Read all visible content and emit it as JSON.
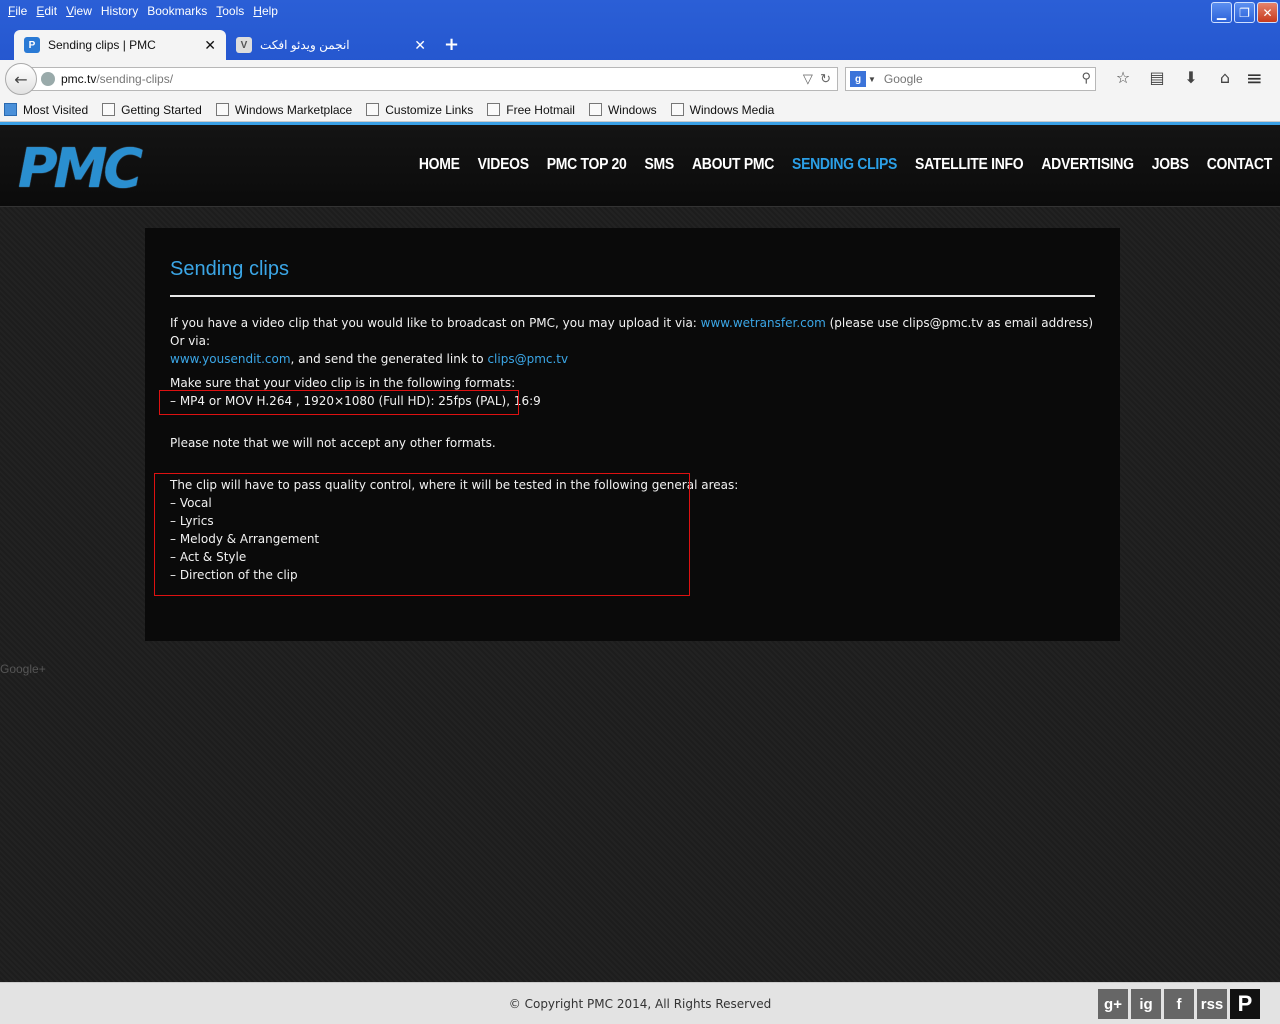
{
  "menubar": {
    "items": [
      {
        "key": "F",
        "rest": "ile"
      },
      {
        "key": "E",
        "rest": "dit"
      },
      {
        "key": "V",
        "rest": "iew"
      },
      {
        "key": "",
        "rest": "History"
      },
      {
        "key": "",
        "rest": "Bookmarks"
      },
      {
        "key": "T",
        "rest": "ools"
      },
      {
        "key": "H",
        "rest": "elp"
      }
    ]
  },
  "tabs": [
    {
      "title": "Sending clips | PMC"
    },
    {
      "title": "انجمن ویدئو افکت"
    }
  ],
  "address": {
    "host": "pmc.tv",
    "path": "/sending-clips/"
  },
  "search": {
    "placeholder": "Google"
  },
  "bookmarks": [
    "Most Visited",
    "Getting Started",
    "Windows Marketplace",
    "Customize Links",
    "Free Hotmail",
    "Windows",
    "Windows Media"
  ],
  "site": {
    "logo": "PMC",
    "nav": [
      "HOME",
      "VIDEOS",
      "PMC TOP 20",
      "SMS",
      "ABOUT PMC",
      "SENDING CLIPS",
      "SATELLITE INFO",
      "ADVERTISING",
      "JOBS",
      "CONTACT"
    ]
  },
  "content": {
    "title": "Sending clips",
    "p1_a": "If you have a video clip that you would like to broadcast on PMC, you may upload it via: ",
    "p1_link1": "www.wetransfer.com",
    "p1_b": " (please use clips@pmc.tv as email address) Or via:",
    "p1_link2": "www.yousendit.com",
    "p1_c": ", and send the generated link to ",
    "p1_link3": "clips@pmc.tv",
    "formats_intro": "Make sure that your video clip is in the following formats:",
    "format_line": "– MP4 or MOV H.264 , 1920×1080 (Full HD): 25fps (PAL), 16:9",
    "note": "Please note that we will not accept any other formats.",
    "qc_intro": "The clip will have to pass quality control, where it will be tested in the following general areas:",
    "qc_items": [
      "– Vocal",
      "– Lyrics",
      "– Melody & Arrangement",
      "– Act & Style",
      "– Direction of the clip"
    ]
  },
  "googleplus": "Google+",
  "footer": {
    "copyright": "© Copyright PMC 2014, All Rights Reserved"
  },
  "social": [
    "g+",
    "ig",
    "f",
    "rss",
    "P"
  ]
}
